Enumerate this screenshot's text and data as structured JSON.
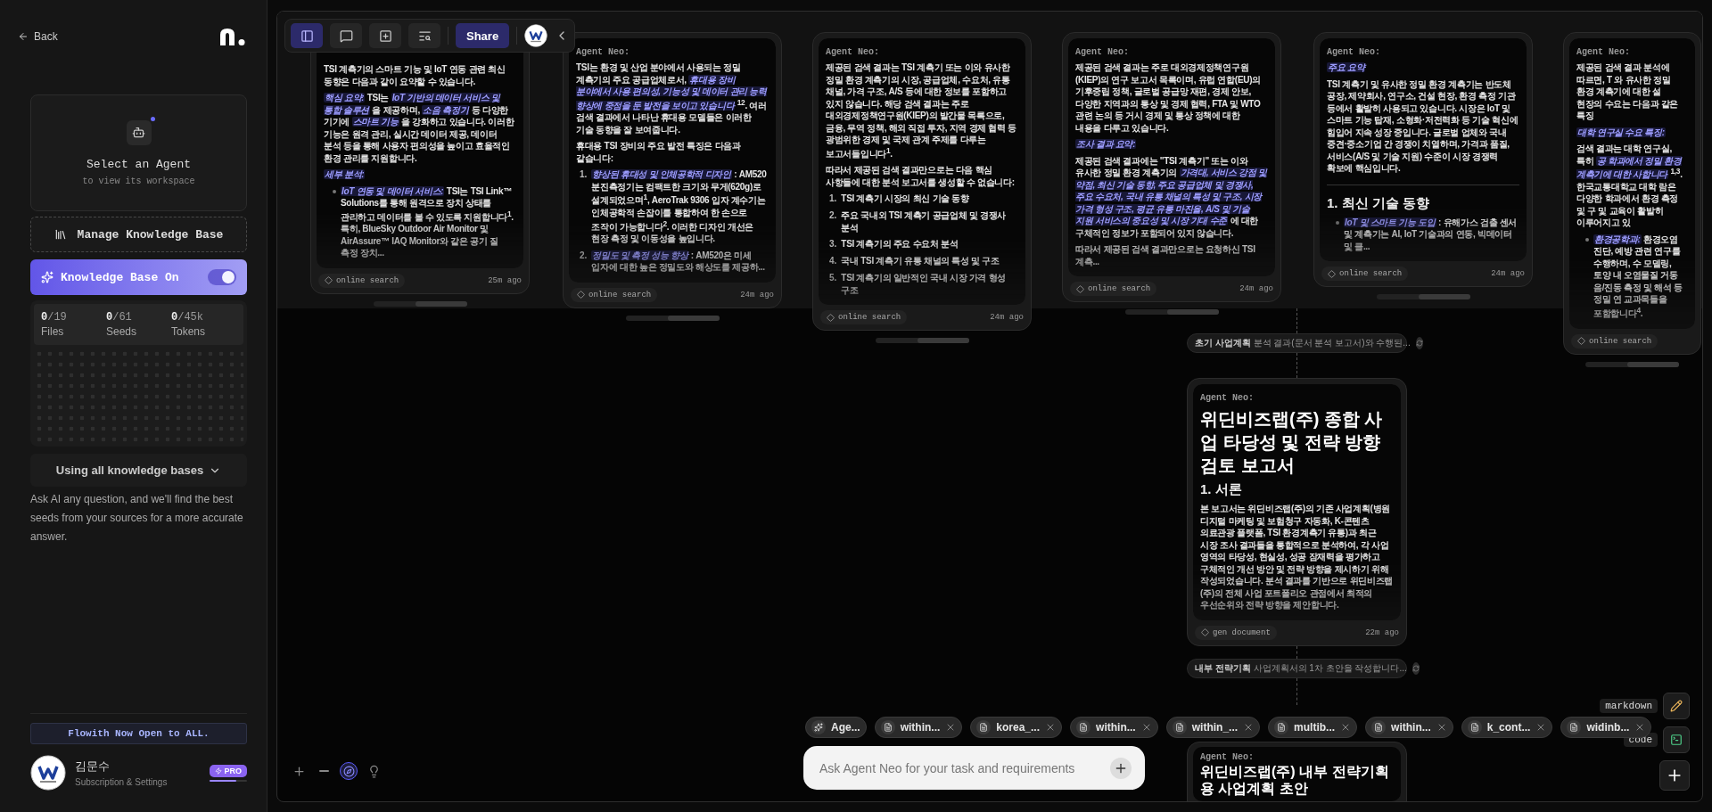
{
  "sidebar": {
    "back": "Back",
    "agent_card": {
      "title": "Select an Agent",
      "subtitle": "to view its workspace"
    },
    "manage_button": "Manage Knowledge Base",
    "knowledge_toggle": {
      "label": "Knowledge Base On",
      "on": true
    },
    "stats": [
      {
        "value": "**0**/19",
        "label": "Files"
      },
      {
        "value": "**0**/61",
        "label": "Seeds"
      },
      {
        "value": "**0**/45k",
        "label": "Tokens"
      }
    ],
    "scope_dropdown": "Using all knowledge bases",
    "help_text": "Ask AI any question, and we'll find the best seeds from your sources for a more accurate answer.",
    "banner": "Flowith Now Open to ALL.",
    "user": {
      "name": "김문수",
      "subtitle": "Subscription & Settings",
      "plan": "PRO",
      "level": 0.7
    }
  },
  "toolbar": {
    "buttons": [
      {
        "kind": "sidebar",
        "selected": true
      },
      {
        "kind": "comment",
        "selected": false
      },
      {
        "kind": "add-screen",
        "selected": false
      },
      {
        "kind": "search-list",
        "selected": false
      }
    ],
    "share": "Share"
  },
  "cards": [
    {
      "source": "online search",
      "time": "25m ago",
      "blocks": [
        {
          "kind": "p",
          "text": "TSI 계측기의 스마트 기능 및 IoT 연동 관련 최신 동향은 다음과 같이 요약할 수 있습니다."
        },
        {
          "kind": "p",
          "text": "*핵심 요약:* TSI는 *IoT 기반의 데이터 서비스 및 통합 솔루션* 을 제공하며, *소음 측정기* 등 다양한 기기에 *스마트 기능* 을 강화하고 있습니다. 이러한 기능은 원격 관리, 실시간 데이터 제공, 데이터 분석 등을 통해 사용자 편의성을 높이고 효율적인 환경 관리를 지원합니다."
        },
        {
          "kind": "p",
          "text": "*세부 분석:*"
        },
        {
          "kind": "ul",
          "text": "*IoT 연동 및 데이터 서비스:* TSI는 TSI Link™ Solutions를 통해 원격으로 장치 상태를 관리하고 데이터를 볼 수 있도록 지원합니다$^{1}$. 특히, BlueSky Outdoor Air Monitor 및 AirAssure™ IAQ Monitor와 같은 공기 질 측정 장치..."
        }
      ]
    },
    {
      "label": "Agent Neo:",
      "source": "online search",
      "time": "24m ago",
      "blocks": [
        {
          "kind": "p",
          "text": "TSI는 환경 및 산업 분야에서 사용되는 정밀 계측기의 주요 공급업체로서, *휴대용 장비 분야에서 사용 편의성, 기능성 및 데이터 관리 능력 향상에 중점을 둔 발전을 보이고 있습니다* $^{12}$. 여러 검색 결과에서 나타난 휴대용 모델들은 이러한 기술 동향을 잘 보여줍니다."
        },
        {
          "kind": "p",
          "text": "휴대용 TSI 장비의 주요 발전 특징은 다음과 같습니다:"
        },
        {
          "kind": "ol",
          "marker": "1.",
          "text": "*향상된 휴대성 및 인체공학적 디자인* : AM520 분진측정기는 컴팩트한 크기와 무게(620g)로 설계되었으며$^{1}$, AeroTrak 9306 입자 계수기는 인체공학적 손잡이를 통합하여 한 손으로 조작이 가능합니다$^{2}$. 이러한 디자인 개선은 현장 측정 및 이동성을 높입니다."
        },
        {
          "kind": "ol",
          "marker": "2.",
          "text": "*정밀도 및 측정 성능 향상* : AM520은 미세 입자에 대한 높은 정밀도와 해상도를 제공하..."
        }
      ]
    },
    {
      "label": "Agent Neo:",
      "source": "online search",
      "time": "24m ago",
      "blocks": [
        {
          "kind": "p",
          "text": "제공된 검색 결과는 TSI 계측기 또는 이와 유사한 정밀 환경 계측기의 시장, 공급업체, 수요처, 유통 채널, 가격 구조, A/S 등에 대한 정보를 포함하고 있지 않습니다. 해당 검색 결과는 주로 대외경제정책연구원(KIEP)의 발간물 목록으로, 금융, 무역 정책, 해외 직접 투자, 지역 경제 협력 등 광범위한 경제 및 국제 관계 주제를 다루는 보고서들입니다$^{1}$."
        },
        {
          "kind": "p",
          "text": "따라서 제공된 검색 결과만으로는 다음 핵심 사항들에 대한 분석 보고서를 생성할 수 없습니다:"
        },
        {
          "kind": "ol",
          "marker": "1.",
          "text": "TSI 계측기 시장의 최신 기술 동향"
        },
        {
          "kind": "ol",
          "marker": "2.",
          "text": "주요 국내외 TSI 계측기 공급업체 및 경쟁사 분석"
        },
        {
          "kind": "ol",
          "marker": "3.",
          "text": "TSI 계측기의 주요 수요처 분석"
        },
        {
          "kind": "ol",
          "marker": "4.",
          "text": "국내 TSI 계측기 유통 채널의 특성 및 구조"
        },
        {
          "kind": "ol",
          "marker": "5.",
          "text": "TSI 계측기의 일반적인 국내 시장 가격 형성 구조"
        }
      ]
    },
    {
      "label": "Agent Neo:",
      "source": "online search",
      "time": "24m ago",
      "blocks": [
        {
          "kind": "p",
          "text": "제공된 검색 결과는 주로 대외경제정책연구원(KIEP)의 연구 보고서 목록이며, 유럽 연합(EU)의 기후중립 정책, 글로벌 공급망 재편, 경제 안보, 다양한 지역과의 통상 및 경제 협력, FTA 및 WTO 관련 논의 등 거시 경제 및 통상 정책에 대한 내용을 다루고 있습니다."
        },
        {
          "kind": "p",
          "text": "*조사 결과 요약:*"
        },
        {
          "kind": "p",
          "text": "제공된 검색 결과에는 \"TSI 계측기\" 또는 이와 유사한 정밀 환경 계측기의 *가격대, 서비스 강점 및 약점, 최신 기술 동향, 주요 공급업체 및 경쟁사, 주요 수요처, 국내 유통 채널의 특성 및 구조, 시장 가격 형성 구조, 평균 유통 마진율, A/S 및 기술 지원 서비스의 중요성 및 시장 기대 수준* 에 대한 구체적인 정보가 포함되어 있지 않습니다."
        },
        {
          "kind": "p",
          "text": "따라서 제공된 검색 결과만으로는 요청하신 TSI 계측..."
        }
      ]
    },
    {
      "label": "Agent Neo:",
      "source": "online search",
      "time": "24m ago",
      "blocks": [
        {
          "kind": "p",
          "text": "*주요 요약*"
        },
        {
          "kind": "p",
          "text": "TSI 계측기 및 유사한 정밀 환경 계측기는 반도체 공장, 제약회사, 연구소, 건설 현장, 환경 측정 기관 등에서 활발히 사용되고 있습니다. 시장은 IoT 및 스마트 기능 탑재, 소형화·저전력화 등 기술 혁신에 힘입어 지속 성장 중입니다. 글로벌 업체와 국내 중견·중소기업 간 경쟁이 치열하며, 가격과 품질, 서비스(A/S 및 기술 지원) 수준이 시장 경쟁력 확보에 핵심입니다."
        },
        {
          "kind": "rule"
        },
        {
          "kind": "h2",
          "text": "1. 최신 기술 동향"
        },
        {
          "kind": "ul",
          "text": "*IoT 및 스마트 기능 도입* : 유해가스 검출 센서 및 계측기는 AI, IoT 기술과의 연동, 빅데이터 및 클..."
        }
      ]
    },
    {
      "label": "Agent Neo:",
      "source": "online search",
      "blocks": [
        {
          "kind": "p",
          "text": "제공된 검색 결과 분석에 따르면, T 와 유사한 정밀 환경 계측기에 대한 설 현장의 수요는 다음과 같은 특징"
        },
        {
          "kind": "p",
          "text": "*대학 연구실 수요 특징:*"
        },
        {
          "kind": "p",
          "text": "검색 결과는 대학 연구실, 특히 *공 학과에서 정밀 환경 계측기에 대한 사합니다* $^{1,3}$. 한국교통대학교 대학 람은 다양한 학과에서 환경 측정 및 구 및 교육이 활발히 이루어지고 있"
        },
        {
          "kind": "ul",
          "text": "*환경공학과:* 환경오염 진단, 예방 관련 연구를 수행하며, 수 모델링, 토양 내 오염물질 거동 음/진동 측정 및 해석 등 정밀 연 교과목들을 포함합니다$^{4}$."
        }
      ]
    }
  ],
  "steps": [
    {
      "text": "**초기 사업계획** 분석 결과(문서 분석 보고서)와 수행된..."
    },
    {
      "text": "**내부 전략기획** 사업계획서의 1차 초안을 작성합니다..."
    }
  ],
  "report": {
    "label": "Agent Neo:",
    "title": "위딘비즈랩(주) 종합 사업 타당성 및 전략 방향 검토 보고서",
    "heading": "1. 서론",
    "text": "본 보고서는 위딘비즈랩(주)의 기존 사업계획(병원 디지털 마케팅 및 보험청구 자동화, K-콘텐츠 의료관광 플랫폼, TSI 환경계측기 유통)과 최근 시장 조사 결과들을 통합적으로 분석하여, 각 사업 영역의 타당성, 현실성, 성공 잠재력을 평가하고 구체적인 개선 방안 및 전략 방향을 제시하기 위해 작성되었습니다. 분석 결과를 기반으로 위딘비즈랩(주)의 전체 사업 포트폴리오 관점에서 최적의 우선순위와 전략 방향을 제안합니다.",
    "source": "gen document",
    "time": "22m ago"
  },
  "draft": {
    "label": "Agent Neo:",
    "title": "위딘비즈랩(주) 내부 전략기획용 사업계획 초안"
  },
  "context_tabs": [
    {
      "kind": "agent",
      "label": "Age..."
    },
    {
      "kind": "file",
      "label": "within..."
    },
    {
      "kind": "file",
      "label": "korea_..."
    },
    {
      "kind": "file",
      "label": "within..."
    },
    {
      "kind": "file",
      "label": "within_..."
    },
    {
      "kind": "file",
      "label": "multib..."
    },
    {
      "kind": "file",
      "label": "within..."
    },
    {
      "kind": "file",
      "label": "k_cont..."
    },
    {
      "kind": "file",
      "label": "widinb..."
    }
  ],
  "prompt": {
    "placeholder": "Ask Agent Neo for your task and requirements"
  },
  "output_modes": [
    {
      "kind": "markdown",
      "label": "markdown"
    },
    {
      "kind": "code",
      "label": "code"
    }
  ]
}
